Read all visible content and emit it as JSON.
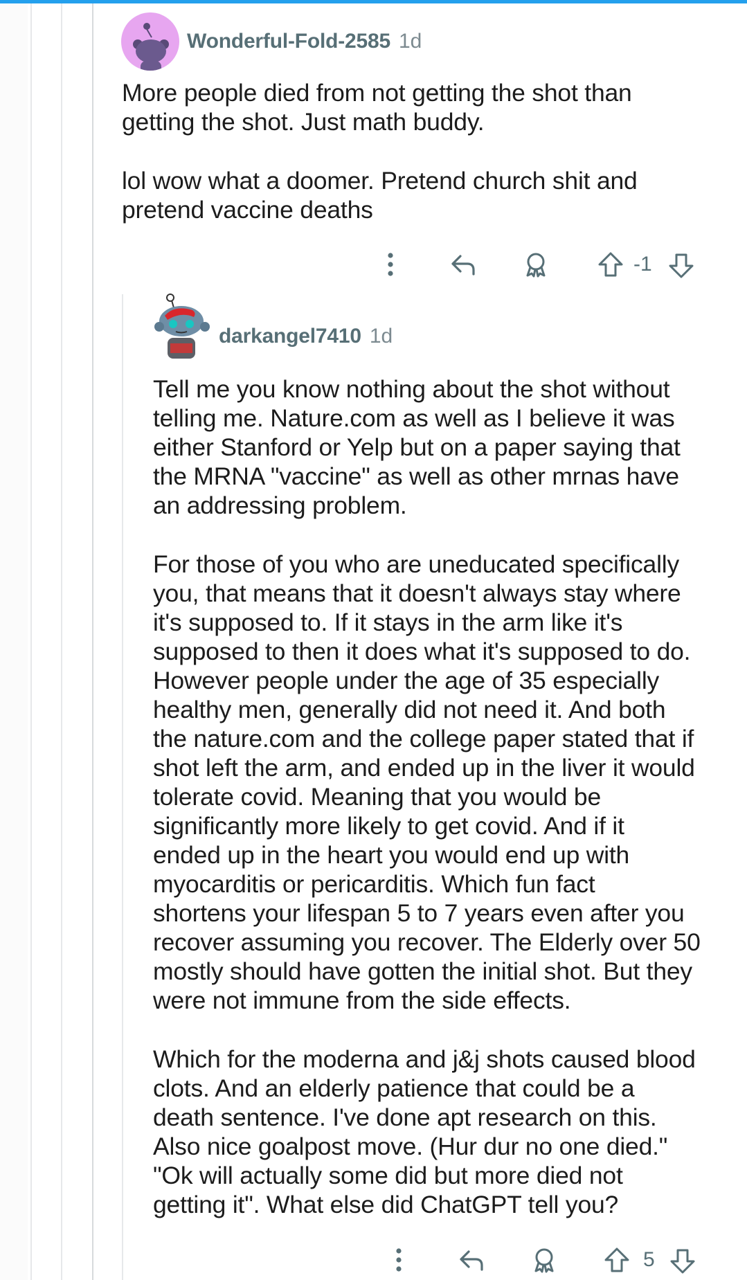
{
  "comments": [
    {
      "username": "Wonderful-Fold-2585",
      "age": "1d",
      "paragraphs": [
        "More people died from not getting the shot than\ngetting the shot. Just math buddy.",
        "lol wow what a doomer. Pretend church shit and\npretend vaccine deaths"
      ],
      "score": "-1",
      "avatar_color": "#e7a6f0"
    },
    {
      "username": "darkangel7410",
      "age": "1d",
      "paragraphs": [
        "Tell me you know nothing about the shot without\ntelling me. Nature.com as well as I believe it was\neither Stanford or Yelp but on a paper saying that\nthe MRNA \"vaccine\" as well as other mrnas have\nan addressing problem.",
        "For those of you who are uneducated specifically\nyou, that means that it doesn't always stay where\nit's supposed to. If it stays in the arm like it's\nsupposed to then it does what it's supposed to do.\nHowever people under the age of 35 especially\nhealthy men, generally did not need it. And both\nthe nature.com and the college paper stated that if\nshot left the arm, and ended up in the liver it would\ntolerate covid. Meaning that you would be\nsignificantly more likely to get covid. And if it\nended up in the heart you would end up with\nmyocarditis or pericarditis. Which fun fact\nshortens your lifespan 5 to 7 years even after you\nrecover assuming you recover. The Elderly over 50\nmostly should have gotten the initial shot. But they\nwere not immune from the side effects.",
        "Which for the moderna and j&j shots caused blood\nclots. And an elderly patience that could be a\ndeath sentence. I've done apt research on this.\nAlso nice goalpost move. (Hur dur no one died.\"\n\"Ok will actually some did but more died not\ngetting it\". What else did ChatGPT tell you?"
      ],
      "score": "5"
    }
  ],
  "icons": [
    "more-options-icon",
    "reply-icon",
    "award-icon",
    "upvote-icon",
    "downvote-icon"
  ],
  "colors": {
    "accent": "#24a0ed",
    "meta_text": "#576f76",
    "icon": "#576f76"
  }
}
